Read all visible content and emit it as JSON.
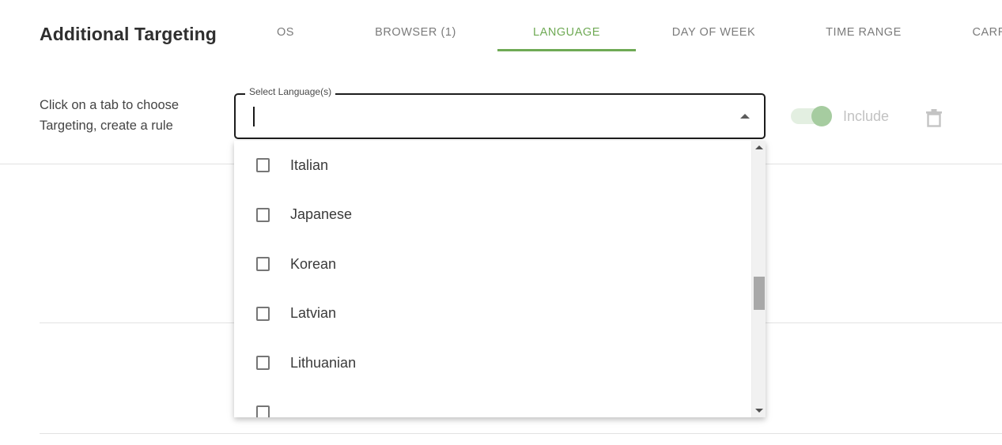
{
  "header": {
    "title": "Additional Targeting",
    "tabs": [
      {
        "label": "OS",
        "active": false
      },
      {
        "label": "BROWSER (1)",
        "active": false
      },
      {
        "label": "LANGUAGE",
        "active": true
      },
      {
        "label": "DAY OF WEEK",
        "active": false
      },
      {
        "label": "TIME RANGE",
        "active": false
      },
      {
        "label": "CARRIER",
        "active": false
      }
    ]
  },
  "helper": {
    "line1": "Click on a tab to choose",
    "line2": "Targeting, create a rule",
    "text": "Click on a tab to choose Targeting, create a rule"
  },
  "select": {
    "legend": "Select Language(s)",
    "value": "",
    "placeholder": "",
    "caret_icon": "caret-up-icon",
    "expanded": true
  },
  "dropdown": {
    "options": [
      {
        "label": "Italian",
        "checked": false
      },
      {
        "label": "Japanese",
        "checked": false
      },
      {
        "label": "Korean",
        "checked": false
      },
      {
        "label": "Latvian",
        "checked": false
      },
      {
        "label": "Lithuanian",
        "checked": false
      }
    ],
    "scrollbar": {
      "up_icon": "scroll-up-arrow-icon",
      "down_icon": "scroll-down-arrow-icon",
      "thumb_position_pct": 49
    }
  },
  "rule": {
    "toggle_label": "Include",
    "toggle_on": true,
    "delete_icon": "trash-icon"
  },
  "colors": {
    "accent_green": "#6faa55",
    "toggle_thumb": "#a6cca0",
    "toggle_track": "#e3efe1",
    "divider": "#e2e2e2",
    "muted_text": "#7b7b7b"
  }
}
